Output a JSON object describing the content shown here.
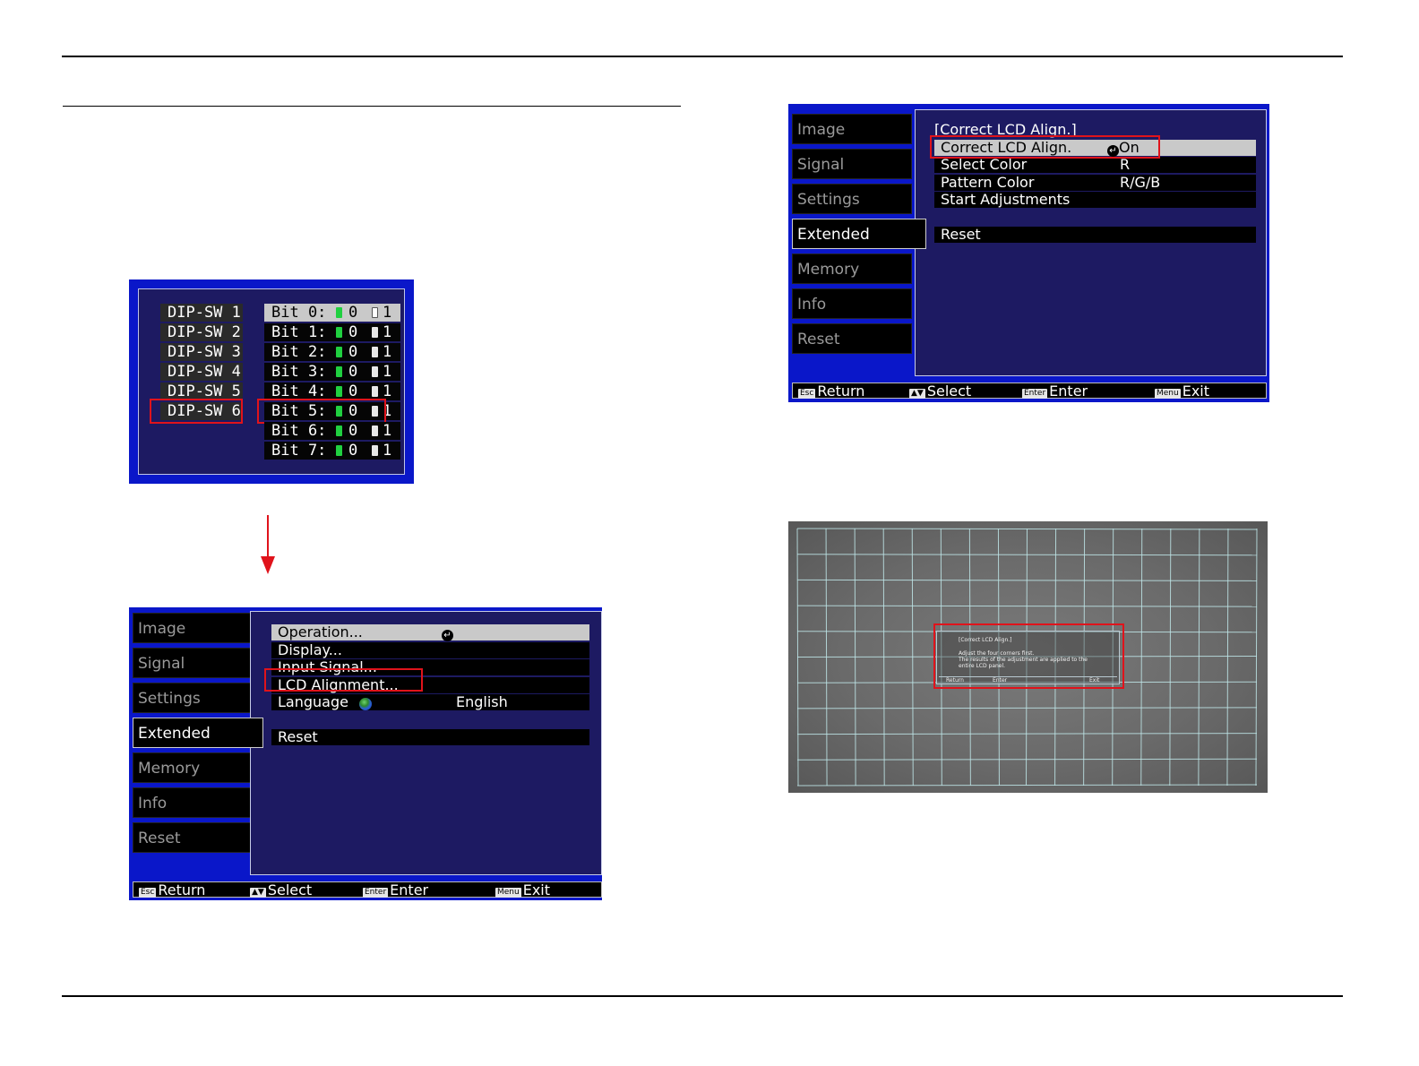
{
  "dip_panel": {
    "switches": [
      "DIP-SW 1",
      "DIP-SW 2",
      "DIP-SW 3",
      "DIP-SW 4",
      "DIP-SW 5",
      "DIP-SW 6"
    ],
    "selected_switch": "DIP-SW 6",
    "bits": [
      {
        "label": "Bit 0:",
        "off": "0",
        "on": "1"
      },
      {
        "label": "Bit 1:",
        "off": "0",
        "on": "1"
      },
      {
        "label": "Bit 2:",
        "off": "0",
        "on": "1"
      },
      {
        "label": "Bit 3:",
        "off": "0",
        "on": "1"
      },
      {
        "label": "Bit 4:",
        "off": "0",
        "on": "1"
      },
      {
        "label": "Bit 5:",
        "off": "0",
        "on": "1"
      },
      {
        "label": "Bit 6:",
        "off": "0",
        "on": "1"
      },
      {
        "label": "Bit 7:",
        "off": "0",
        "on": "1"
      }
    ],
    "selected_bit": "Bit 5:"
  },
  "menu_extended": {
    "tabs": [
      "Image",
      "Signal",
      "Settings",
      "Extended",
      "Memory",
      "Info",
      "Reset"
    ],
    "active_tab": "Extended",
    "rows": [
      {
        "label": "Operation...",
        "value": ""
      },
      {
        "label": "Display...",
        "value": ""
      },
      {
        "label": "Input Signal...",
        "value": ""
      },
      {
        "label": "LCD Alignment...",
        "value": ""
      },
      {
        "label": "Language",
        "value": "English"
      }
    ],
    "reset_row": "Reset",
    "footer": [
      {
        "key": "Esc",
        "label": "Return"
      },
      {
        "key": "▲▼",
        "label": "Select"
      },
      {
        "key": "Enter",
        "label": "Enter"
      },
      {
        "key": "Menu",
        "label": "Exit"
      }
    ],
    "colors": {
      "frame": "#0a17c9",
      "panel": "#1d1a62",
      "highlight": "#e0131b"
    }
  },
  "menu_lcd_align": {
    "tabs": [
      "Image",
      "Signal",
      "Settings",
      "Extended",
      "Memory",
      "Info",
      "Reset"
    ],
    "active_tab": "Extended",
    "heading": "[Correct LCD Align.]",
    "rows": [
      {
        "label": "Correct LCD Align.",
        "value": "On"
      },
      {
        "label": "Select Color",
        "value": "R"
      },
      {
        "label": "Pattern Color",
        "value": "R/G/B"
      },
      {
        "label": "Start Adjustments",
        "value": ""
      }
    ],
    "reset_row": "Reset",
    "footer": [
      {
        "key": "Esc",
        "label": "Return"
      },
      {
        "key": "▲▼",
        "label": "Select"
      },
      {
        "key": "Enter",
        "label": "Enter"
      },
      {
        "key": "Menu",
        "label": "Exit"
      }
    ]
  },
  "grid_photo": {
    "osd_title": "[Correct LCD Align.]",
    "osd_line1": "Adjust the four corners first.",
    "osd_line2": "The results of the adjustment are applied to the",
    "osd_line3": "entire LCD panel.",
    "osd_footer": [
      "Return",
      "Enter",
      "Exit"
    ]
  }
}
